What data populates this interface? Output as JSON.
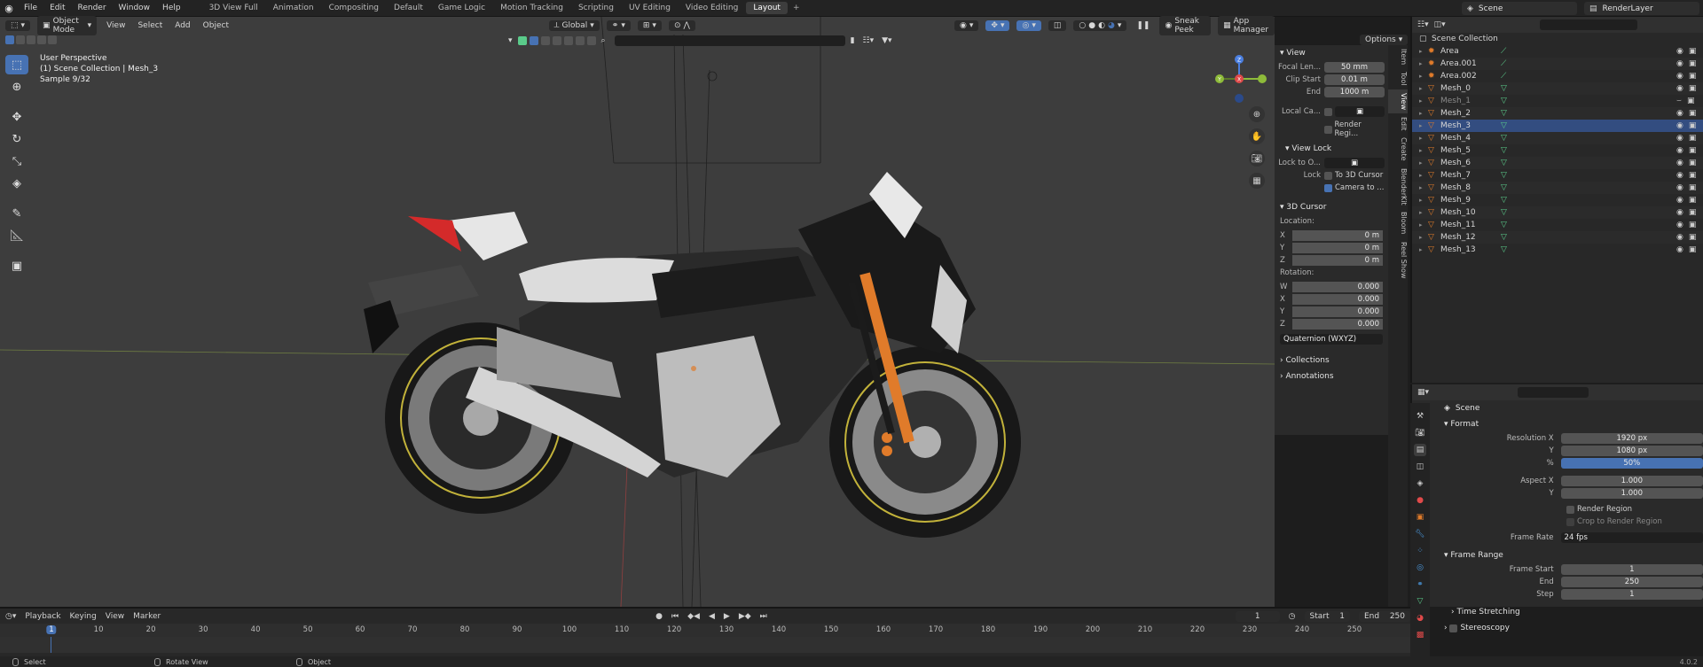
{
  "menubar": {
    "menus": [
      "File",
      "Edit",
      "Render",
      "Window",
      "Help"
    ],
    "workspaces": [
      "3D View Full",
      "Animation",
      "Compositing",
      "Default",
      "Game Logic",
      "Motion Tracking",
      "Scripting",
      "UV Editing",
      "Video Editing",
      "Layout"
    ],
    "active_workspace": "Layout",
    "add_tab": "+",
    "scene_label": "Scene",
    "view_layer_label": "RenderLayer"
  },
  "viewport_header": {
    "mode": "Object Mode",
    "menus": [
      "View",
      "Select",
      "Add",
      "Object"
    ],
    "transform_orientation": "Global",
    "sneak_peek": "Sneak Peek",
    "app_manager": "App Manager",
    "options": "Options"
  },
  "viewport_info": {
    "perspective": "User Perspective",
    "collection_line": "(1) Scene Collection | Mesh_3",
    "sample": "Sample 9/32"
  },
  "gizmo": {
    "x": "X",
    "y": "Y",
    "z": "Z"
  },
  "npanel": {
    "tabs": [
      "Item",
      "Tool",
      "View",
      "Edit",
      "Create",
      "BlenderKit",
      "Bloom",
      "Reel Show"
    ],
    "active_tab": "View",
    "view_section": "View",
    "focal_length_label": "Focal Len...",
    "focal_length": "50 mm",
    "clip_start_label": "Clip Start",
    "clip_start": "0.01 m",
    "clip_end_label": "End",
    "clip_end": "1000 m",
    "local_camera_label": "Local Ca...",
    "render_region_label": "Render Regi...",
    "view_lock_section": "View Lock",
    "lock_to_object_label": "Lock to O...",
    "lock_label": "Lock",
    "to_3d_cursor": "To 3D Cursor",
    "camera_to": "Camera to ...",
    "cursor_section": "3D Cursor",
    "location_label": "Location:",
    "loc": [
      [
        "X",
        "0 m"
      ],
      [
        "Y",
        "0 m"
      ],
      [
        "Z",
        "0 m"
      ]
    ],
    "rotation_label": "Rotation:",
    "rot": [
      [
        "W",
        "0.000"
      ],
      [
        "X",
        "0.000"
      ],
      [
        "Y",
        "0.000"
      ],
      [
        "Z",
        "0.000"
      ]
    ],
    "rotation_mode": "Quaternion (WXYZ)",
    "collections": "Collections",
    "annotations": "Annotations"
  },
  "outliner": {
    "root": "Scene Collection",
    "items": [
      {
        "name": "Area",
        "type": "light"
      },
      {
        "name": "Area.001",
        "type": "light"
      },
      {
        "name": "Area.002",
        "type": "light"
      },
      {
        "name": "Mesh_0",
        "type": "mesh"
      },
      {
        "name": "Mesh_1",
        "type": "mesh",
        "dim": true
      },
      {
        "name": "Mesh_2",
        "type": "mesh"
      },
      {
        "name": "Mesh_3",
        "type": "mesh",
        "selected": true
      },
      {
        "name": "Mesh_4",
        "type": "mesh"
      },
      {
        "name": "Mesh_5",
        "type": "mesh"
      },
      {
        "name": "Mesh_6",
        "type": "mesh"
      },
      {
        "name": "Mesh_7",
        "type": "mesh"
      },
      {
        "name": "Mesh_8",
        "type": "mesh"
      },
      {
        "name": "Mesh_9",
        "type": "mesh"
      },
      {
        "name": "Mesh_10",
        "type": "mesh"
      },
      {
        "name": "Mesh_11",
        "type": "mesh"
      },
      {
        "name": "Mesh_12",
        "type": "mesh"
      },
      {
        "name": "Mesh_13",
        "type": "mesh"
      }
    ]
  },
  "properties": {
    "context": "Scene",
    "format_section": "Format",
    "res_x_label": "Resolution X",
    "res_x": "1920 px",
    "res_y_label": "Y",
    "res_y": "1080 px",
    "pct_label": "%",
    "pct": "50%",
    "aspect_x_label": "Aspect X",
    "aspect_x": "1.000",
    "aspect_y_label": "Y",
    "aspect_y": "1.000",
    "render_region": "Render Region",
    "crop_region": "Crop to Render Region",
    "frame_rate_label": "Frame Rate",
    "frame_rate": "24 fps",
    "frame_range_section": "Frame Range",
    "frame_start_label": "Frame Start",
    "frame_start": "1",
    "end_label": "End",
    "end": "250",
    "step_label": "Step",
    "step": "1",
    "time_stretching": "Time Stretching",
    "stereoscopy": "Stereoscopy"
  },
  "timeline": {
    "menus": [
      "Playback",
      "Keying",
      "View",
      "Marker"
    ],
    "current_frame": "1",
    "start_label": "Start",
    "start": "1",
    "end_label": "End",
    "end": "250",
    "ticks": [
      "1",
      "10",
      "20",
      "30",
      "40",
      "50",
      "60",
      "70",
      "80",
      "90",
      "100",
      "110",
      "120",
      "130",
      "140",
      "150",
      "160",
      "170",
      "180",
      "190",
      "200",
      "210",
      "220",
      "230",
      "240",
      "250"
    ]
  },
  "status": {
    "select": "Select",
    "rotate_view": "Rotate View",
    "object": "Object",
    "version": "4.0.2"
  },
  "colors": {
    "accent": "#4772b3",
    "selected_row": "#334d80",
    "tail_light": "#d42a2a",
    "fork": "#e07b2a"
  }
}
